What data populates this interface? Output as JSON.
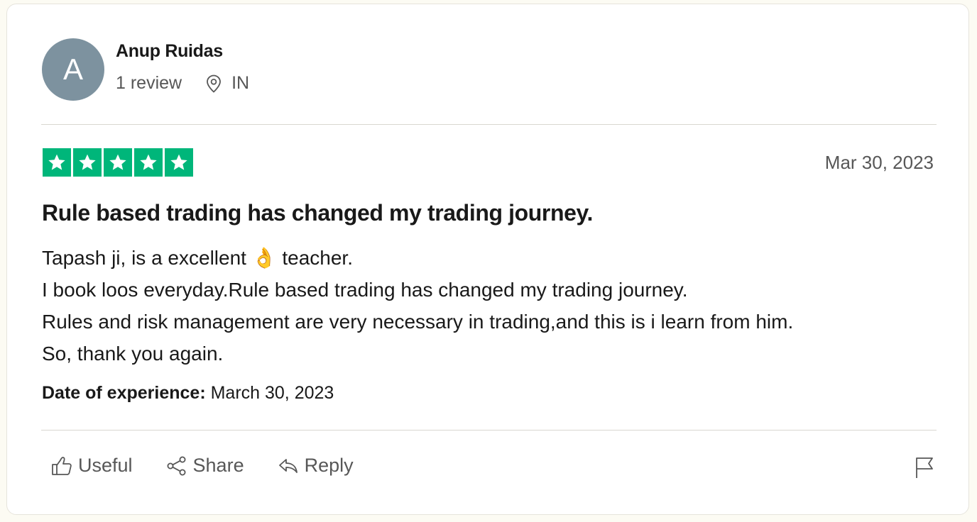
{
  "reviewer": {
    "avatar_letter": "A",
    "avatar_color": "#7d929f",
    "name": "Anup Ruidas",
    "review_count": "1 review",
    "location": "IN",
    "location_icon": "map-pin-icon"
  },
  "review": {
    "rating": 5,
    "rating_max": 5,
    "star_color": "#00b67a",
    "date": "Mar 30, 2023",
    "title": "Rule based trading has changed my trading journey.",
    "body_lines": [
      "Tapash ji, is a excellent 👌 teacher.",
      "I book loos everyday.Rule based trading has changed my trading journey.",
      "Rules and risk management are very necessary in trading,and this is i learn from him.",
      "So, thank you again."
    ],
    "experience_label": "Date of experience:",
    "experience_date": "March 30, 2023"
  },
  "actions": {
    "useful_label": "Useful",
    "useful_icon": "thumbs-up-icon",
    "share_label": "Share",
    "share_icon": "share-icon",
    "reply_label": "Reply",
    "reply_icon": "reply-icon",
    "flag_icon": "flag-icon"
  }
}
